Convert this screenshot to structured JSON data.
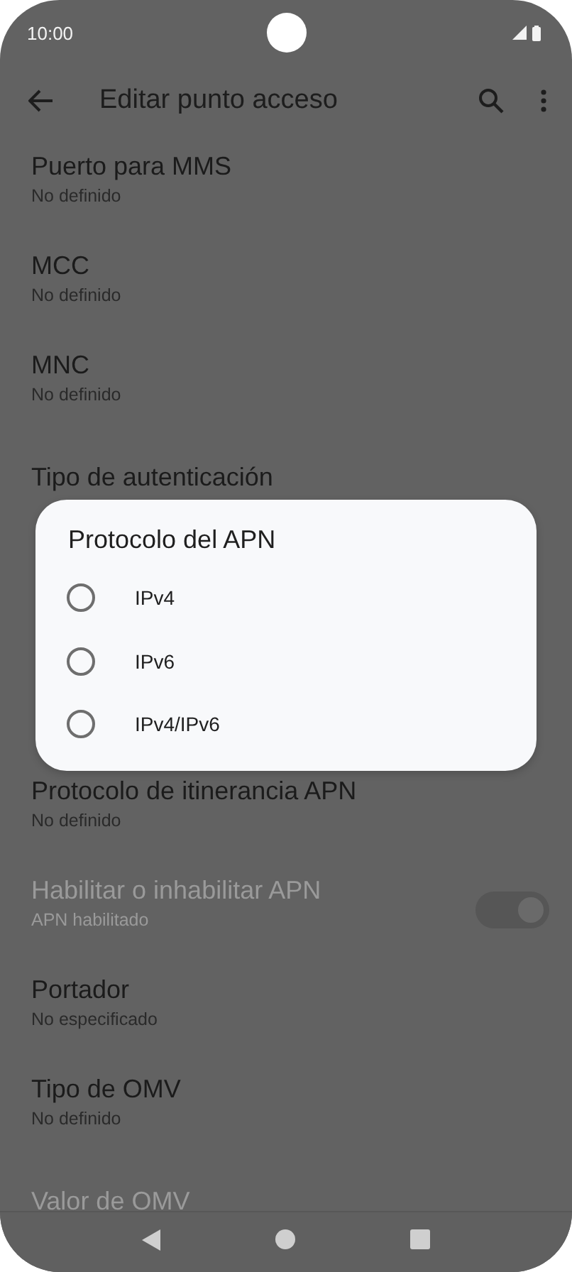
{
  "status_bar": {
    "time": "10:00"
  },
  "app_bar": {
    "title": "Editar punto acceso"
  },
  "rows_above": [
    {
      "title": "Puerto para MMS",
      "summary": "No definido",
      "disabled": false
    },
    {
      "title": "MCC",
      "summary": "No definido",
      "disabled": false
    },
    {
      "title": "MNC",
      "summary": "No definido",
      "disabled": false
    },
    {
      "title": "Tipo de autenticación",
      "disabled": false
    }
  ],
  "rows_below": [
    {
      "kind": "item",
      "title": "Protocolo de itinerancia APN",
      "summary": "No definido",
      "disabled": false
    },
    {
      "kind": "switch",
      "title": "Habilitar o inhabilitar APN",
      "summary": "APN habilitado",
      "disabled": true,
      "on": true
    },
    {
      "kind": "item",
      "title": "Portador",
      "summary": "No especificado",
      "disabled": false
    },
    {
      "kind": "item",
      "title": "Tipo de OMV",
      "summary": "No definido",
      "disabled": false
    },
    {
      "kind": "item",
      "title": "Valor de OMV",
      "disabled": true
    }
  ],
  "dialog": {
    "title": "Protocolo del APN",
    "options": [
      {
        "label": "IPv4",
        "selected": false
      },
      {
        "label": "IPv6",
        "selected": false
      },
      {
        "label": "IPv4/IPv6",
        "selected": false
      }
    ]
  }
}
